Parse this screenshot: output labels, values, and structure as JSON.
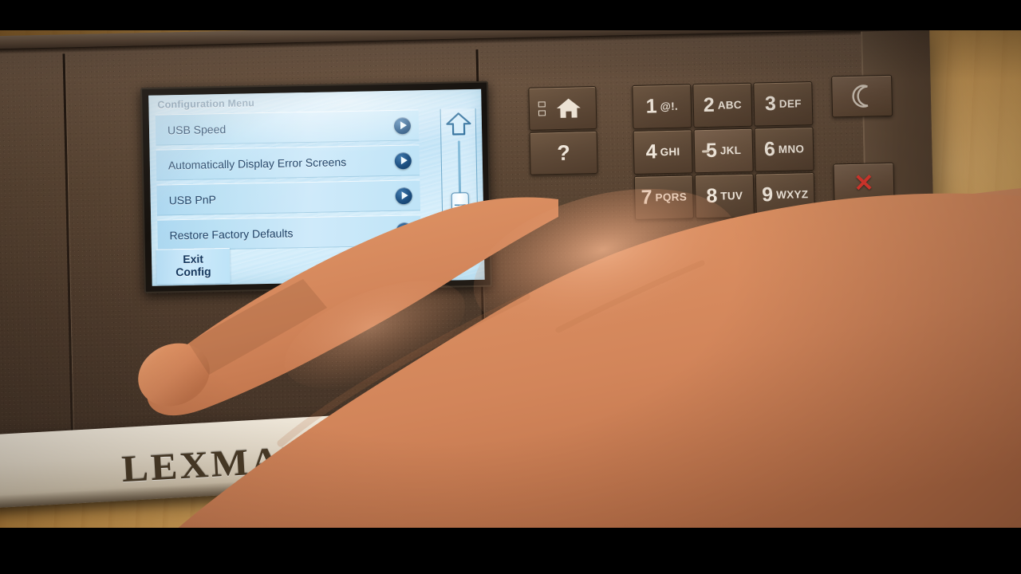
{
  "device": {
    "brand": "LEXMARK",
    "body_color": "#4e3b2c",
    "desk_color": "#dda85c"
  },
  "lcd": {
    "title": "Configuration Menu",
    "accent_color": "#1d4f80",
    "text_color": "#1d3f63",
    "row_color": "#bde0f4",
    "menu_items": [
      {
        "label": "USB Speed",
        "chevron": "chevron-right-icon"
      },
      {
        "label": "Automatically Display Error Screens",
        "chevron": "chevron-right-icon"
      },
      {
        "label": "USB PnP",
        "chevron": "chevron-right-icon"
      },
      {
        "label": "Restore Factory Defaults",
        "chevron": "chevron-right-icon"
      }
    ],
    "scrollbar": {
      "up_arrow_icon": "arrow-up-icon",
      "thumb_position_percent": 55
    },
    "exit_button": {
      "line1": "Exit",
      "line2": "Config"
    }
  },
  "keypad": {
    "keys": [
      {
        "num": "1",
        "letters": "@!."
      },
      {
        "num": "2",
        "letters": "ABC"
      },
      {
        "num": "3",
        "letters": "DEF"
      },
      {
        "num": "4",
        "letters": "GHI"
      },
      {
        "num": "5",
        "letters": "JKL"
      },
      {
        "num": "6",
        "letters": "MNO"
      },
      {
        "num": "7",
        "letters": "PQRS"
      },
      {
        "num": "8",
        "letters": "TUV"
      },
      {
        "num": "9",
        "letters": "WXYZ"
      }
    ]
  },
  "buttons": {
    "home": {
      "icon": "home-icon",
      "label": ""
    },
    "help": {
      "icon": "question-mark-icon",
      "label": "?"
    },
    "sleep": {
      "icon": "moon-icon",
      "label": ""
    },
    "cancel": {
      "icon": "x-cancel-icon",
      "label": "✕",
      "color": "#e0392f"
    }
  }
}
